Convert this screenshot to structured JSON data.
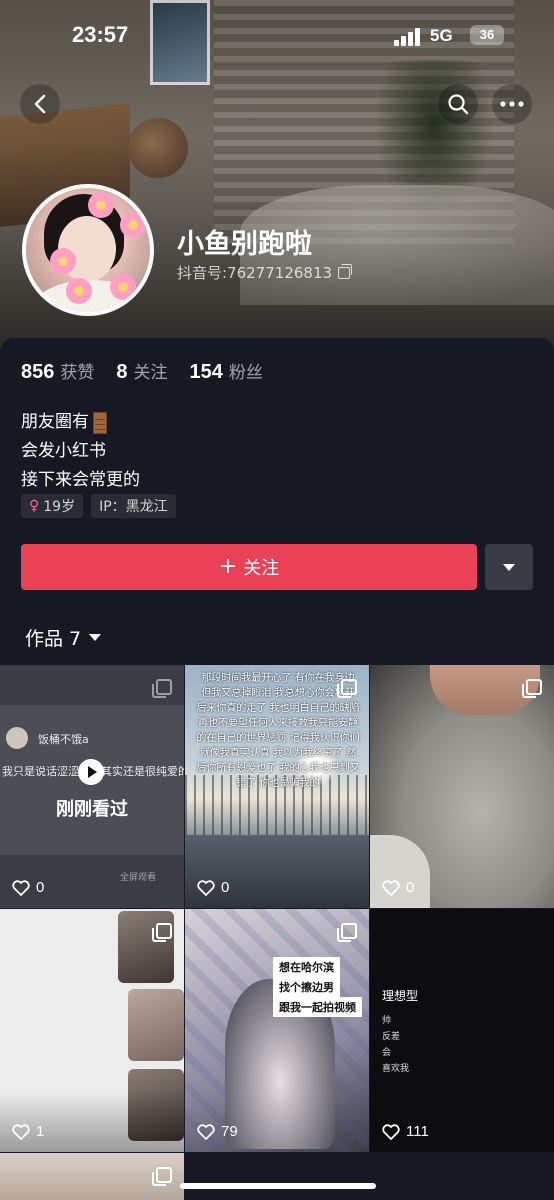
{
  "status_bar": {
    "time": "23:57",
    "network": "5G",
    "battery": "36"
  },
  "profile": {
    "name": "小鱼别跑啦",
    "douyin_id": "抖音号:76277126813",
    "stats": [
      {
        "num": "856",
        "label": "获赞"
      },
      {
        "num": "8",
        "label": "关注"
      },
      {
        "num": "154",
        "label": "粉丝"
      }
    ],
    "bio": [
      "朋友圈有",
      "会发小红书",
      "接下来会常更的"
    ],
    "tags": {
      "age": "19岁",
      "ip": "IP：黑龙江"
    },
    "follow_label": "关注",
    "works_label": "作品 7"
  },
  "works": [
    {
      "likes": "0",
      "user": "饭桶不饿a",
      "line": "我只是说话涩涩的，其实还是很纯爱的",
      "watched": "刚刚看过",
      "fullscreen": "全屏观看"
    },
    {
      "likes": "0",
      "caption": "那段时间我最开心了 有你在我身边 但我又总掉眼泪 我总想心你会离开 后来你真的走了 我也明白自己的缺陷 再也不要望任何人来接救我只能安静的在自己的世界惩罚 记得我认识你们就像我真实认真 我以为我终究了 然后你所有恩爱也了 我的心我也只到又错了 你也是骗我的"
    },
    {
      "likes": "0"
    },
    {
      "likes": "1"
    },
    {
      "likes": "79",
      "labels": [
        "想在哈尔滨",
        "找个擦边男",
        "跟我一起拍视频"
      ]
    },
    {
      "likes": "111",
      "heading": "理想型",
      "lines": [
        "帅",
        "反差",
        "会",
        "喜欢我"
      ]
    }
  ],
  "colors": {
    "accent": "#ea4157",
    "background": "#161823"
  }
}
